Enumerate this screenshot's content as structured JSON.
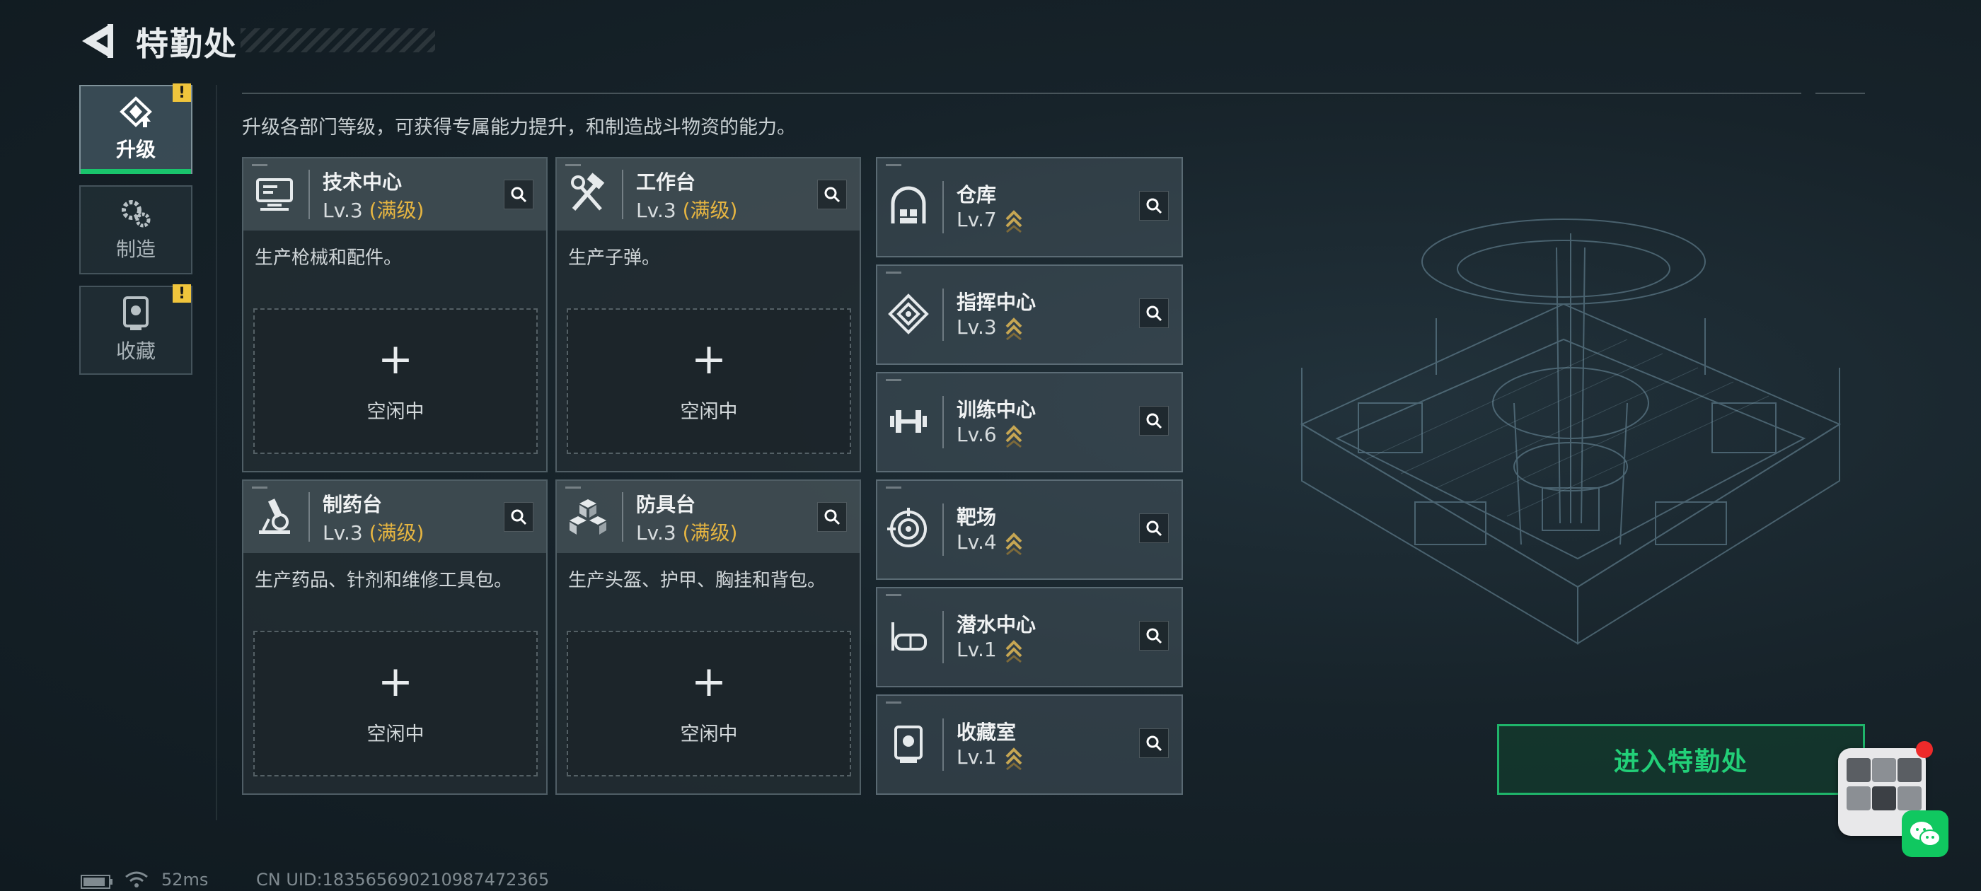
{
  "header": {
    "title": "特勤处"
  },
  "side_tabs": [
    {
      "label": "升级",
      "active": true,
      "warning": "!"
    },
    {
      "label": "制造",
      "active": false
    },
    {
      "label": "收藏",
      "active": false,
      "warning": "!"
    }
  ],
  "description": "升级各部门等级，可获得专属能力提升，和制造战斗物资的能力。",
  "big_cards": [
    {
      "name": "技术中心",
      "level": "Lv.3",
      "max_label": "(满级)",
      "desc": "生产枪械和配件。",
      "slot_plus": "+",
      "slot_status": "空闲中",
      "icon": "monitor-icon"
    },
    {
      "name": "工作台",
      "level": "Lv.3",
      "max_label": "(满级)",
      "desc": "生产子弹。",
      "slot_plus": "+",
      "slot_status": "空闲中",
      "icon": "tools-icon"
    },
    {
      "name": "制药台",
      "level": "Lv.3",
      "max_label": "(满级)",
      "desc": "生产药品、针剂和维修工具包。",
      "slot_plus": "+",
      "slot_status": "空闲中",
      "icon": "microscope-icon"
    },
    {
      "name": "防具台",
      "level": "Lv.3",
      "max_label": "(满级)",
      "desc": "生产头盔、护甲、胸挂和背包。",
      "slot_plus": "+",
      "slot_status": "空闲中",
      "icon": "armor-cubes-icon"
    }
  ],
  "small_cards": [
    {
      "name": "仓库",
      "level": "Lv.7",
      "icon": "warehouse-icon"
    },
    {
      "name": "指挥中心",
      "level": "Lv.3",
      "icon": "command-icon"
    },
    {
      "name": "训练中心",
      "level": "Lv.6",
      "icon": "dumbbell-icon"
    },
    {
      "name": "靶场",
      "level": "Lv.4",
      "icon": "target-icon"
    },
    {
      "name": "潜水中心",
      "level": "Lv.1",
      "icon": "diving-mask-icon"
    },
    {
      "name": "收藏室",
      "level": "Lv.1",
      "icon": "collection-icon"
    }
  ],
  "enter_button": "进入特勤处",
  "status_bar": {
    "ping": "52ms",
    "uid": "CN UID:1835656902109874723​65"
  },
  "colors": {
    "accent_green": "#22cf78",
    "max_gold": "#e6b541",
    "warning": "#f0c53c"
  }
}
